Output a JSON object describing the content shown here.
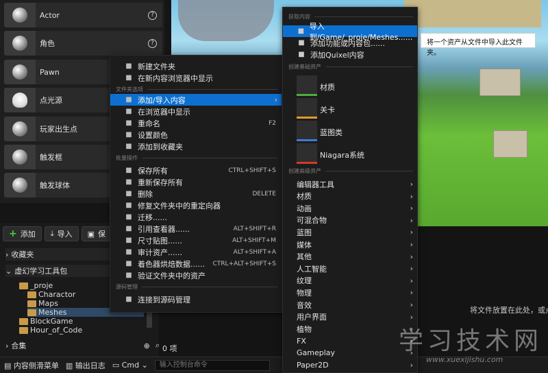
{
  "placer_items": [
    {
      "label": "Actor",
      "icon": "sphere-icon",
      "help": "?"
    },
    {
      "label": "角色",
      "icon": "character-icon",
      "help": "?"
    },
    {
      "label": "Pawn",
      "icon": "pawn-icon"
    },
    {
      "label": "点光源",
      "icon": "light-bulb-icon"
    },
    {
      "label": "玩家出生点",
      "icon": "player-start-icon"
    },
    {
      "label": "触发框",
      "icon": "trigger-box-icon"
    },
    {
      "label": "触发球体",
      "icon": "trigger-sphere-icon"
    }
  ],
  "content_browser": {
    "add_label": "添加",
    "import_label": "导入",
    "save_label": "保",
    "favorites_label": "收藏夹",
    "project_label": "虚幻学习工具包",
    "tree": [
      "_proje",
      "Charactor",
      "Maps",
      "Meshes",
      "BlockGame",
      "Hour_of_Code"
    ],
    "collections_label": "合集",
    "item_count": "0 项",
    "drop_hint": "将文件放置在此处，或点"
  },
  "statusbar": {
    "drawer_label": "内容侧滑菜单",
    "output_label": "输出日志",
    "cmd_label": "Cmd",
    "cmd_placeholder": "输入控制台命令"
  },
  "context_menu": {
    "items_top": [
      {
        "label": "新建文件夹",
        "icon": "new-folder-icon"
      },
      {
        "label": "在新内容浏览器中显示",
        "icon": "browser-icon"
      }
    ],
    "section_folder": "文件夹选项",
    "items_folder": [
      {
        "label": "添加/导入内容",
        "icon": "import-icon",
        "highlight": true,
        "arrow": "›"
      },
      {
        "label": "在浏览器中显示",
        "icon": "show-in-browser-icon"
      },
      {
        "label": "重命名",
        "icon": "rename-icon",
        "shortcut": "F2"
      },
      {
        "label": "设置颜色",
        "icon": "color-icon"
      },
      {
        "label": "添加到收藏夹",
        "icon": "star-icon"
      }
    ],
    "section_batch": "批量操作",
    "items_batch": [
      {
        "label": "保存所有",
        "icon": "save-icon",
        "shortcut": "CTRL+SHIFT+S"
      },
      {
        "label": "重新保存所有",
        "icon": "resave-icon"
      },
      {
        "label": "删除",
        "icon": "delete-icon",
        "shortcut": "DELETE"
      },
      {
        "label": "修复文件夹中的重定向器",
        "icon": "wrench-icon"
      },
      {
        "label": "迁移......",
        "icon": "migrate-icon"
      },
      {
        "label": "引用查看器......",
        "icon": "reference-icon",
        "shortcut": "ALT+SHIFT+R"
      },
      {
        "label": "尺寸贴图......",
        "icon": "size-map-icon",
        "shortcut": "ALT+SHIFT+M"
      },
      {
        "label": "审计资产......",
        "icon": "audit-icon",
        "shortcut": "ALT+SHIFT+A"
      },
      {
        "label": "着色器烘焙数据......",
        "icon": "shader-icon",
        "shortcut": "CTRL+ALT+SHIFT+S"
      },
      {
        "label": "验证文件夹中的资产",
        "icon": "flask-icon"
      }
    ],
    "section_source": "源码管理",
    "items_source": [
      {
        "label": "连接到源码管理",
        "icon": "source-control-icon"
      }
    ]
  },
  "submenu": {
    "section_get": "获取内容",
    "items_get": [
      {
        "label": "导入到/Game/_proje/Meshes......",
        "icon": "import-icon",
        "highlight": true
      },
      {
        "label": "添加功能或内容包......",
        "icon": "add-pack-icon"
      },
      {
        "label": "添加Quixel内容",
        "icon": "quixel-icon"
      }
    ],
    "section_basic": "创建基础资产",
    "basic_assets": [
      {
        "label": "材质",
        "icon": "material-icon",
        "color": "#4caf3a"
      },
      {
        "label": "关卡",
        "icon": "level-icon",
        "color": "#e09b2a"
      },
      {
        "label": "蓝图类",
        "icon": "blueprint-icon",
        "color": "#3d7bd6"
      },
      {
        "label": "Niagara系统",
        "icon": "niagara-icon",
        "color": "#d33b2a"
      }
    ],
    "section_advanced": "创建高级资产",
    "advanced": [
      "编辑器工具",
      "材质",
      "动画",
      "可混合物",
      "蓝图",
      "媒体",
      "其他",
      "人工智能",
      "纹理",
      "物理",
      "音效",
      "用户界面",
      "植物",
      "FX",
      "Gameplay",
      "Paper2D"
    ]
  },
  "tooltip": "将一个资产从文件中导入此文件夹。",
  "watermark": {
    "title": "学习技术网",
    "url": "www.xuexijishu.com"
  }
}
